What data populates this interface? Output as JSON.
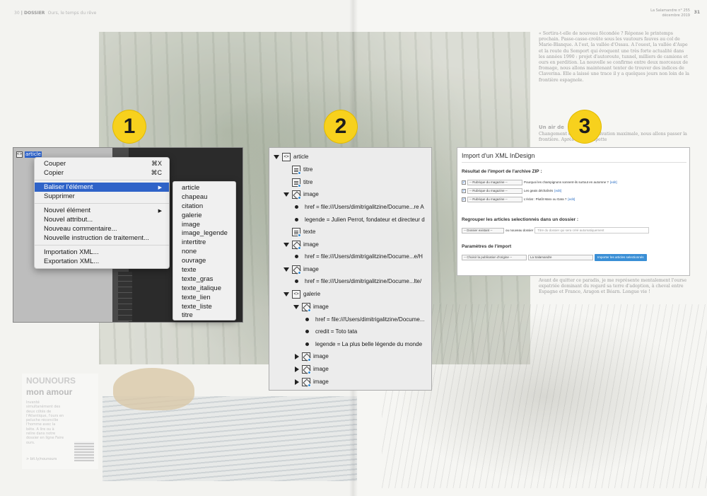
{
  "magazine": {
    "left_folio": "30",
    "left_section": "DOSSIER",
    "left_title": "Ours, le temps du rêve",
    "right_header_line1": "La Salamandre n° 255",
    "right_header_line2": "décembre 2019",
    "right_folio": "31",
    "body_top": "« Sortira-t-elle de nouveau fécondée ? Réponse le printemps prochain. Passe-casse-croûte sous les vautours fauves au col de Marie-Blanque. A l'est, la vallée d'Ossau. A l'ouest, la vallée d'Aspe et la route du Somport qui évoquent une très forte actualité dans les années 1990 : projet d'autoroute, tunnel, milliers de camions et ours en perdition. La nouvelle se confirme entre deux morceaux de fromage, nous allons maintenant tenter de trouver des indices de Claverina. Elle a laissé une trace il y a quelques jours non loin de la frontière espagnole.",
    "subhead": "Un air de",
    "body_mid": "Changement de cap, et motivation maximale, nous allons passer la frontière. Après une grimpette",
    "body_bottom": "Avant de quitter ce paradis, je me représente mentalement l'ourse expatriée dominant du regard sa terre d'adoption, à cheval entre Espagne et France, Aragon et Béarn. Longue vie !",
    "sidebar_title1": "NOUNOURS",
    "sidebar_title2": "mon amour",
    "sidebar_text": "Inventé simultanément des deux côtés de l'Atlantique, l'ours en peluche réconcilie l'homme avec la bête. A lire ou à relire dans notre dossier en ligne Faire ours.",
    "sidebar_link": "> bit.ly/nounours"
  },
  "badges": [
    "1",
    "2",
    "3"
  ],
  "panel1": {
    "root_label": "article",
    "menu": [
      {
        "label": "Couper",
        "shortcut": "⌘X"
      },
      {
        "label": "Copier",
        "shortcut": "⌘C"
      },
      {
        "label": "Baliser l'élément",
        "submenu": true,
        "highlighted": true
      },
      {
        "label": "Supprimer"
      },
      {
        "label": "Nouvel élément",
        "submenu": true
      },
      {
        "label": "Nouvel attribut..."
      },
      {
        "label": "Nouveau commentaire..."
      },
      {
        "label": "Nouvelle instruction de traitement..."
      },
      {
        "label": "Importation XML..."
      },
      {
        "label": "Exportation XML..."
      }
    ],
    "submenu": [
      "article",
      "chapeau",
      "citation",
      "galerie",
      "image",
      "image_legende",
      "intertitre",
      "none",
      "ouvrage",
      "texte",
      "texte_gras",
      "texte_italique",
      "texte_lien",
      "texte_liste",
      "titre"
    ]
  },
  "panel2": {
    "tree": [
      {
        "label": "article"
      },
      {
        "label": "titre"
      },
      {
        "label": "titre"
      },
      {
        "label": "image"
      },
      {
        "label": "href = file:///Users/dimitrigalitzine/Docume...re A"
      },
      {
        "label": "legende = Julien Perrot, fondateur et directeur d"
      },
      {
        "label": "texte"
      },
      {
        "label": "image"
      },
      {
        "label": "href = file:///Users/dimitrigalitzine/Docume...e/H"
      },
      {
        "label": "image"
      },
      {
        "label": "href = file:///Users/dimitrigalitzine/Docume...lte/"
      },
      {
        "label": "galerie"
      },
      {
        "label": "image"
      },
      {
        "label": "href = file:///Users/dimitrigalitzine/Docume..."
      },
      {
        "label": "credit = Toto tata"
      },
      {
        "label": "legende = La plus belle légende du monde"
      },
      {
        "label": "image"
      },
      {
        "label": "image"
      },
      {
        "label": "image"
      }
    ]
  },
  "panel3": {
    "title": "Import d'un XML InDesign",
    "result_heading": "Résultat de l'import de l'archive ZIP :",
    "rows": [
      {
        "select": "-- Rubrique du magazine --",
        "text": "Pourquoi les champignons sonnent-ils surtout en automne ?",
        "link": "[edit]"
      },
      {
        "select": "-- Rubrique du magazine --",
        "text": "Les geais déchaînés",
        "link": "[edit]"
      },
      {
        "select": "-- Rubrique du magazine --",
        "text": "L'éclat : Plutôt Marx ou Gaïa ?",
        "link": "[edit]"
      }
    ],
    "group_heading": "Regrouper les articles selectionnés dans un dossier :",
    "folder_select": "-- Dossier existant --",
    "or_new": "ou nouveau dossier",
    "folder_placeholder": "Titre du dossier qui sera créé automatiquement",
    "params_heading": "Paramètres de l'import",
    "pub_select": "-- Choisir la publication d'origine --",
    "pub_value": "La Salamandre",
    "import_button": "Importer les articles selectionnés"
  }
}
